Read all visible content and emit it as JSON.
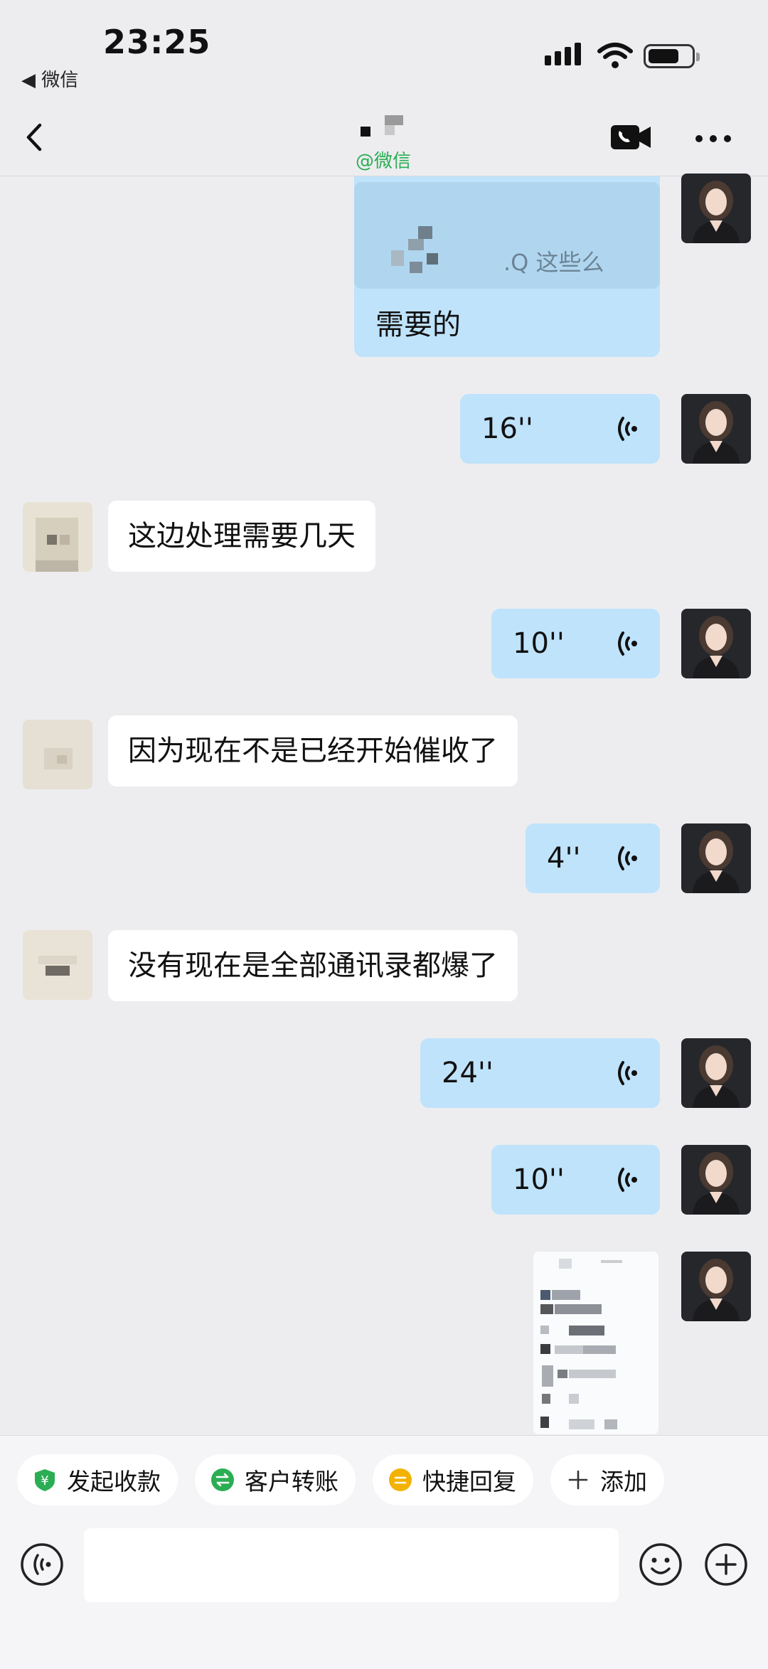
{
  "status_bar": {
    "time": "23:25",
    "back_app": "◀ 微信"
  },
  "header": {
    "subtitle": "@微信"
  },
  "messages": {
    "quote_text": ".Q 这些么",
    "need": "需要的",
    "v1": "16''",
    "t1": "这边处理需要几天",
    "v2": "10''",
    "t2": "因为现在不是已经开始催收了",
    "v3": "4''",
    "t3": "没有现在是全部通讯录都爆了",
    "v4": "24''",
    "v5": "10''"
  },
  "quickbar": {
    "receive": "发起收款",
    "transfer": "客户转账",
    "quick_reply": "快捷回复",
    "add": "添加"
  },
  "colors": {
    "self_bubble": "#bfe3fb",
    "peer_bubble": "#ffffff",
    "brand_green": "#2bae53"
  }
}
